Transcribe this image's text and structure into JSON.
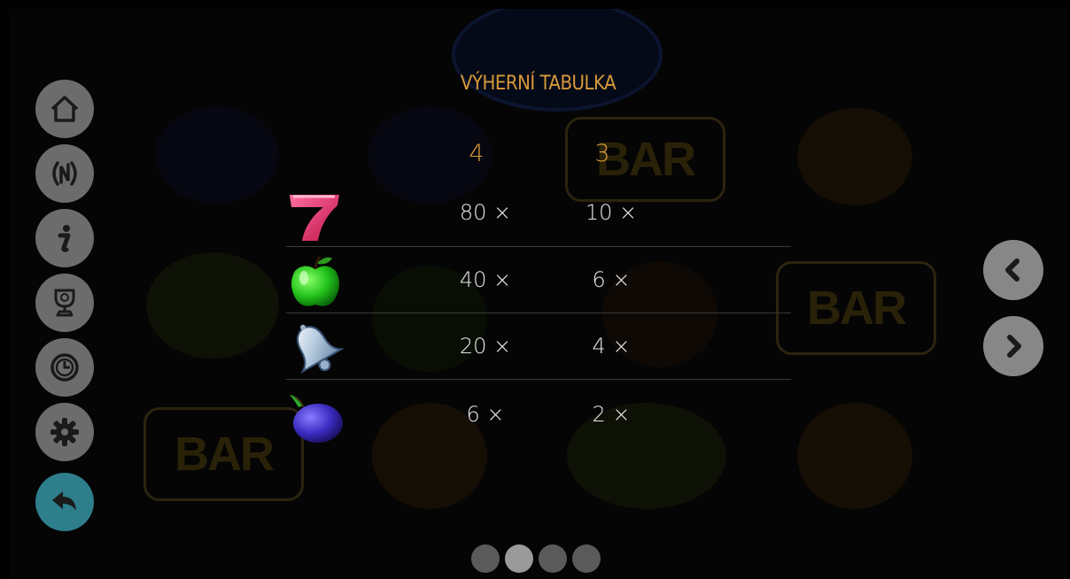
{
  "title": "VÝHERNÍ TABULKA",
  "columns": [
    "4",
    "3"
  ],
  "rows": [
    {
      "symbol": "seven-icon",
      "pay4": "80 ×",
      "pay3": "10 ×"
    },
    {
      "symbol": "apple-icon",
      "pay4": "40 ×",
      "pay3": "6 ×"
    },
    {
      "symbol": "bell-icon",
      "pay4": "20 ×",
      "pay3": "4 ×"
    },
    {
      "symbol": "plum-icon",
      "pay4": "6 ×",
      "pay3": "2 ×"
    }
  ],
  "menu": [
    "home-icon",
    "game-logo-icon",
    "info-icon",
    "trophy-icon",
    "history-icon",
    "settings-icon",
    "back-icon"
  ],
  "nav": [
    "chevron-left-icon",
    "chevron-right-icon"
  ],
  "pages": {
    "count": 4,
    "active": 2
  },
  "colors": {
    "accent": "#d89a3a",
    "menu_button": "#6c6c6c",
    "back_button": "#2e7e8c",
    "text": "#e6e6e6"
  }
}
